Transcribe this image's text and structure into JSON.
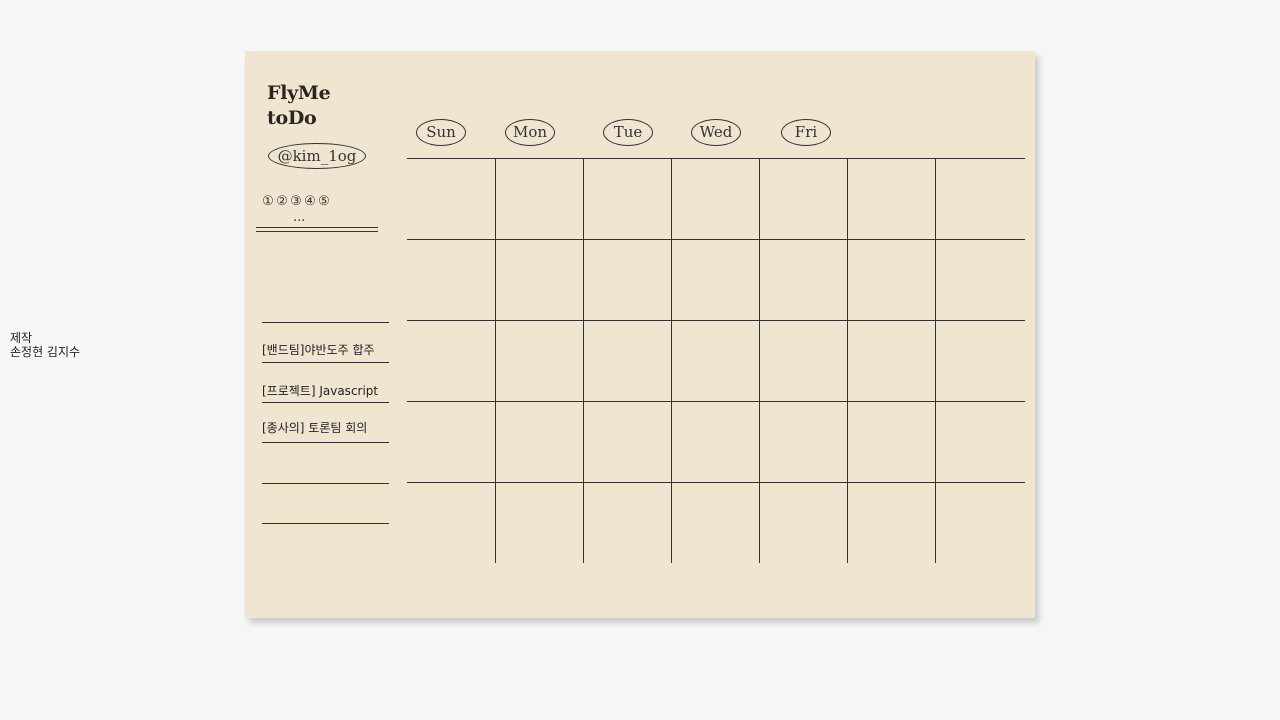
{
  "credit": {
    "line1": "제작",
    "line2": "손정현 김지수"
  },
  "app": {
    "title_line1": "FlyMe",
    "title_line2": "toDo",
    "handle": "@kim_1og"
  },
  "pagination": {
    "pages": [
      "①",
      "②",
      "③",
      "④",
      "⑤"
    ],
    "more": "..."
  },
  "todos": [
    "[밴드팀]야반도주 합주",
    "[프로젝트] Javascript",
    "[종사의] 토론팀 회의"
  ],
  "days": [
    "Sun",
    "Mon",
    "Tue",
    "Wed",
    "Fri"
  ],
  "colors": {
    "paper": "#f0e5d1",
    "background": "#f6f6f6",
    "ink": "#333333"
  }
}
